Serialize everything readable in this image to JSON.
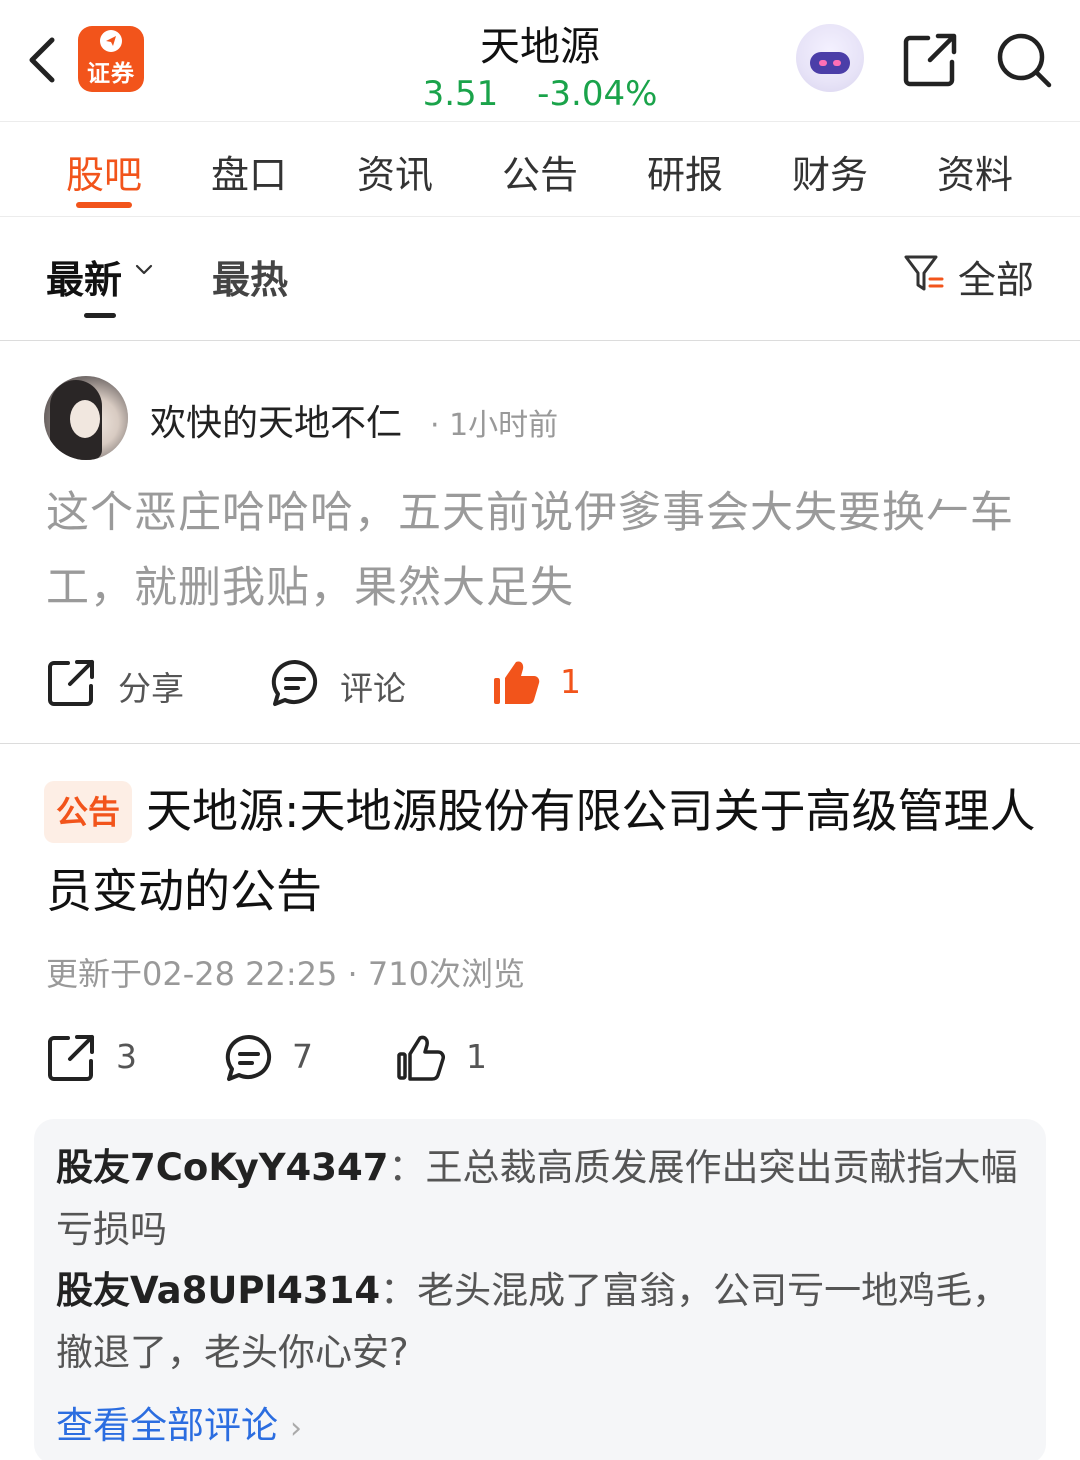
{
  "header": {
    "back_icon": "chevron-left-icon",
    "app_logo_text": "证券",
    "stock_name": "天地源",
    "price": "3.51",
    "change_pct": "-3.04%",
    "quote_color": "#1aa34a",
    "accent_color": "#f2541b",
    "robot_icon": "robot-assistant-icon",
    "share_icon": "share-icon",
    "search_icon": "search-icon"
  },
  "tabs": [
    {
      "label": "股吧",
      "active": true
    },
    {
      "label": "盘口",
      "active": false
    },
    {
      "label": "资讯",
      "active": false
    },
    {
      "label": "公告",
      "active": false
    },
    {
      "label": "研报",
      "active": false
    },
    {
      "label": "财务",
      "active": false
    },
    {
      "label": "资料",
      "active": false
    }
  ],
  "sort": {
    "latest_label": "最新",
    "hot_label": "最热",
    "filter_label": "全部"
  },
  "posts": [
    {
      "author": "欢快的天地不仁",
      "time": "· 1小时前",
      "content": "这个恶庄哈哈哈，五天前说伊爹事会大失要换𠂉车工，就删我贴，果然大足失",
      "share_label": "分享",
      "comment_label": "评论",
      "like_count": "1"
    },
    {
      "badge": "公告",
      "title": "天地源:天地源股份有限公司关于高级管理人员变动的公告",
      "meta": "更新于02-28 22:25 · 710次浏览",
      "share_count": "3",
      "comment_count": "7",
      "like_count": "1",
      "comments": [
        {
          "user": "股友7CoKyY4347",
          "text": "：王总裁高质发展作出突出贡献指大幅亏损吗"
        },
        {
          "user": "股友Va8UPl4314",
          "text": "：老头混成了富翁，公司亏一地鸡毛，撤退了，老头你心安?"
        }
      ],
      "view_all_label": "查看全部评论"
    }
  ]
}
